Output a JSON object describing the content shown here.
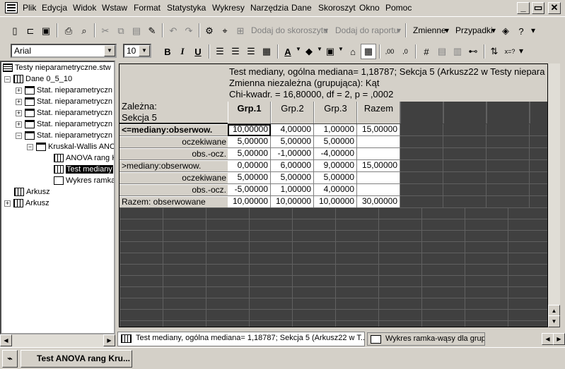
{
  "menu": {
    "items": [
      "Plik",
      "Edycja",
      "Widok",
      "Wstaw",
      "Format",
      "Statystyka",
      "Wykresy",
      "Narzędzia",
      "Dane",
      "Skoroszyt",
      "Okno",
      "Pomoc"
    ],
    "minimize": "_",
    "restore": "▭",
    "close": "✕"
  },
  "toolbar1": {
    "add_to_workbook": "Dodaj do skoroszytu",
    "add_to_report": "Dodaj do raportu",
    "variables": "Zmienne",
    "cases": "Przypadki"
  },
  "toolbar2": {
    "font": "Arial",
    "font_size": "10",
    "bold": "B",
    "italic": "I",
    "underline": "U"
  },
  "tree": {
    "root": "Testy nieparametryczne.stw",
    "dataset": "Dane 0_5_10",
    "stat_items": [
      "Stat. nieparametryczn",
      "Stat. nieparametryczn",
      "Stat. nieparametryczn",
      "Stat. nieparametryczn",
      "Stat. nieparametryczn"
    ],
    "kruskal": "Kruskal-Wallis ANC",
    "anova": "ANOVA rang K",
    "median": "Test mediany",
    "boxplot": "Wykres ramka",
    "sheet1": "Arkusz",
    "sheet2": "Arkusz"
  },
  "sheet": {
    "title_line1": "Test mediany, ogólna mediana= 1,18787; Sekcja 5 (Arkusz22 w Testy niepara",
    "title_line2": "Zmienna niezależna (grupująca): Kąt",
    "title_line3": "Chi-kwadr. = 16,80000, df = 2, p = ,0002",
    "stub_line1": "Zależna:",
    "stub_line2": "Sekcja 5",
    "columns": [
      "Grp.1",
      "Grp.2",
      "Grp.3",
      "Razem"
    ],
    "rows": [
      {
        "label": "<=mediany:obserwow.",
        "values": [
          "10,00000",
          "4,00000",
          "1,00000",
          "15,00000"
        ]
      },
      {
        "label": "oczekiwane",
        "values": [
          "5,00000",
          "5,00000",
          "5,00000",
          ""
        ]
      },
      {
        "label": "obs.-ocz.",
        "values": [
          "5,00000",
          "-1,00000",
          "-4,00000",
          ""
        ]
      },
      {
        "label": ">mediany:obserwow.",
        "values": [
          "0,00000",
          "6,00000",
          "9,00000",
          "15,00000"
        ]
      },
      {
        "label": "oczekiwane",
        "values": [
          "5,00000",
          "5,00000",
          "5,00000",
          ""
        ]
      },
      {
        "label": "obs.-ocz.",
        "values": [
          "-5,00000",
          "1,00000",
          "4,00000",
          ""
        ]
      },
      {
        "label": "Razem: obserwowane",
        "values": [
          "10,00000",
          "10,00000",
          "10,00000",
          "30,00000"
        ]
      }
    ]
  },
  "tabs": {
    "tab1": "Test mediany, ogólna mediana= 1,18787; Sekcja 5 (Arkusz22 w T...",
    "tab2": "Wykres ramka-wąsy dla grup"
  },
  "taskbar": {
    "task": "Test ANOVA rang Kru..."
  }
}
